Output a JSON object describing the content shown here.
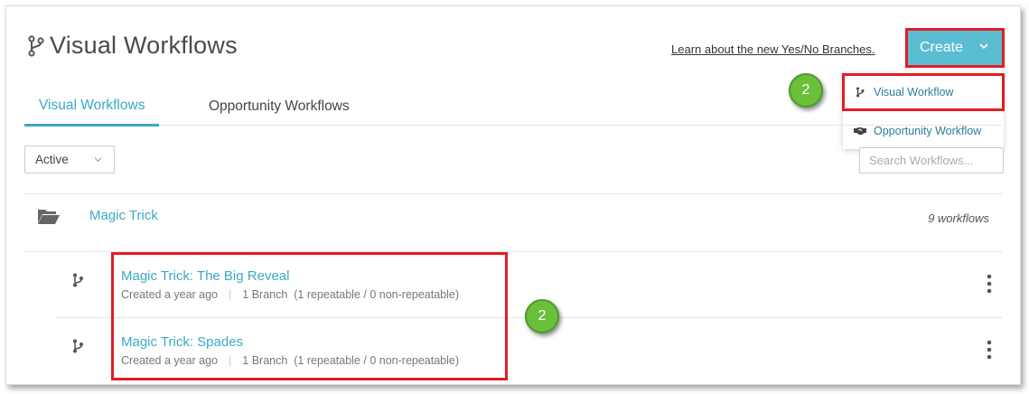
{
  "header": {
    "title": "Visual Workflows",
    "learn_link": "Learn about the new Yes/No Branches.",
    "create_label": "Create"
  },
  "create_menu": {
    "items": [
      {
        "label": "Visual Workflow",
        "icon": "branch-icon"
      },
      {
        "label": "Opportunity Workflow",
        "icon": "handshake-icon"
      }
    ]
  },
  "tabs": [
    {
      "label": "Visual Workflows",
      "active": true
    },
    {
      "label": "Opportunity Workflows",
      "active": false
    }
  ],
  "filter": {
    "value": "Active"
  },
  "search": {
    "placeholder": "Search Workflows..."
  },
  "folder": {
    "name": "Magic Trick",
    "count": "9 workflows"
  },
  "workflows": [
    {
      "name": "Magic Trick: The Big Reveal",
      "created": "Created a year ago",
      "branches": "1 Branch",
      "detail": "(1 repeatable / 0 non-repeatable)"
    },
    {
      "name": "Magic Trick: Spades",
      "created": "Created a year ago",
      "branches": "1 Branch",
      "detail": "(1 repeatable / 0 non-repeatable)"
    }
  ],
  "callouts": [
    "2",
    "2"
  ],
  "colors": {
    "accent": "#3aa9c5",
    "create_button": "#5bbdd2",
    "highlight": "#e21d24",
    "callout_badge": "#6abf3b"
  }
}
